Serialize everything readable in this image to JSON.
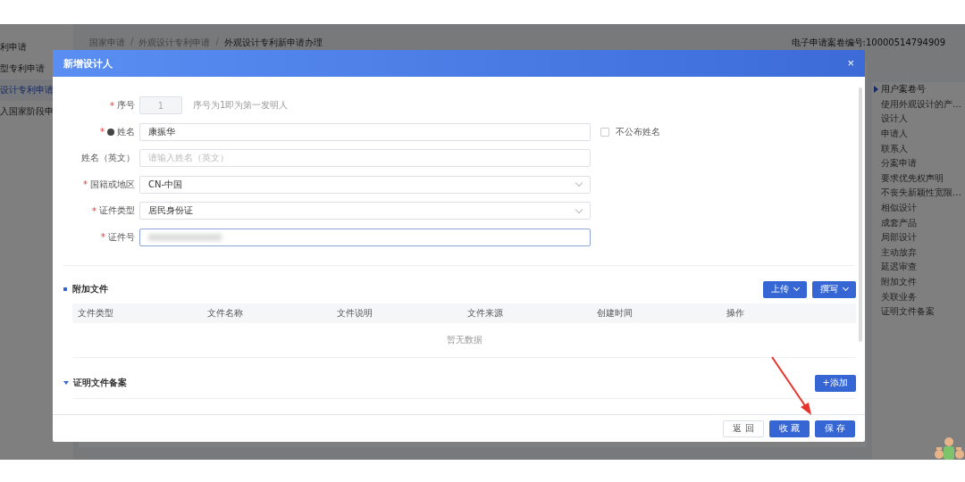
{
  "sidebar": {
    "items": [
      {
        "label": "利申请",
        "selected": false
      },
      {
        "label": "型专利申请",
        "selected": false
      },
      {
        "label": "设计专利申请",
        "selected": true
      },
      {
        "label": "入国家阶段申",
        "selected": false
      }
    ]
  },
  "breadcrumb": [
    {
      "kind": "link",
      "text": "国家申请"
    },
    {
      "kind": "separator",
      "text": "/"
    },
    {
      "kind": "link",
      "text": "外观设计专利申请"
    },
    {
      "kind": "separator",
      "text": "/"
    },
    {
      "kind": "current",
      "text": "外观设计专利新申请办理"
    }
  ],
  "case_number": "电子申请案卷编号:10000514794909",
  "outline": {
    "items": [
      {
        "label": "用户案卷号",
        "selected": true
      },
      {
        "label": "使用外观设计的产…",
        "selected": false
      },
      {
        "label": "设计人",
        "selected": false
      },
      {
        "label": "申请人",
        "selected": false
      },
      {
        "label": "联系人",
        "selected": false
      },
      {
        "label": "分案申请",
        "selected": false
      },
      {
        "label": "要求优先权声明",
        "selected": false
      },
      {
        "label": "不丧失新颖性宽限…",
        "selected": false
      },
      {
        "label": "相似设计",
        "selected": false
      },
      {
        "label": "成套产品",
        "selected": false
      },
      {
        "label": "局部设计",
        "selected": false
      },
      {
        "label": "主动放弃",
        "selected": false
      },
      {
        "label": "延迟审查",
        "selected": false
      },
      {
        "label": "附加文件",
        "selected": false
      },
      {
        "label": "关联业务",
        "selected": false
      },
      {
        "label": "证明文件备案",
        "selected": false
      }
    ]
  },
  "dialog": {
    "title": "新增设计人",
    "close": "×",
    "fields": [
      {
        "kind": "text",
        "label": "序号",
        "required_mark": "*",
        "value": "1",
        "disabled": true,
        "hint": "序号为1即为第一发明人"
      },
      {
        "kind": "text",
        "label": "姓名",
        "required_mark": "*",
        "info": true,
        "value": "康振华",
        "option": {
          "label": "不公布姓名",
          "checked": false
        }
      },
      {
        "kind": "text",
        "label": "姓名（英文）",
        "placeholder": "请输入姓名（英文）"
      },
      {
        "kind": "select",
        "label": "国籍或地区",
        "required_mark": "*",
        "value": "CN-中国"
      },
      {
        "kind": "select",
        "label": "证件类型",
        "required_mark": "*",
        "value": "居民身份证"
      },
      {
        "kind": "text",
        "label": "证件号",
        "required_mark": "*",
        "redacted": true,
        "focused": true
      }
    ],
    "sections": [
      {
        "title": "附加文件",
        "kind": "square",
        "actions": [
          {
            "label": "上传",
            "dropdown": true
          },
          {
            "label": "撰写",
            "dropdown": true
          }
        ],
        "table": {
          "columns": [
            "文件类型",
            "文件名称",
            "文件说明",
            "文件来源",
            "创建时间",
            "操作"
          ],
          "empty_text": "暂无数据"
        }
      },
      {
        "title": "证明文件备案",
        "kind": "triangle",
        "actions": [
          {
            "label": "+添加",
            "dropdown": false
          }
        ]
      }
    ],
    "buttons": [
      {
        "label": "返 回",
        "kind": "default"
      },
      {
        "label": "收 藏",
        "kind": "primary"
      },
      {
        "label": "保 存",
        "kind": "primary"
      }
    ]
  }
}
